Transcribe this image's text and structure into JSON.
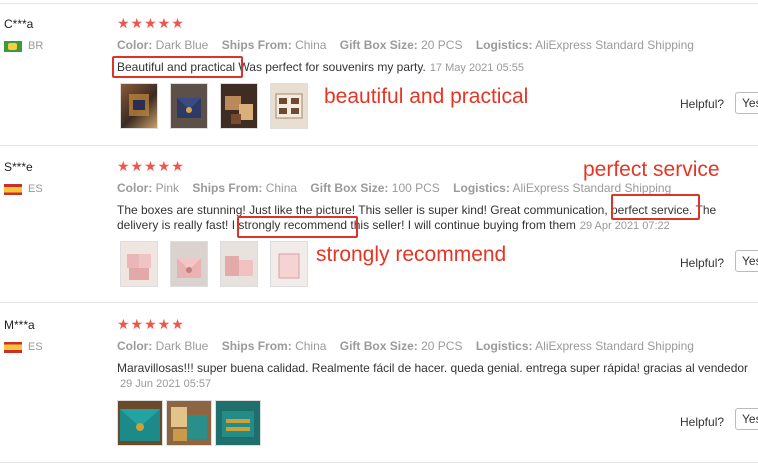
{
  "reviews": [
    {
      "user": "C***a",
      "country": "BR",
      "stars": "★★★★★",
      "attrs": {
        "color_label": "Color:",
        "color": "Dark Blue",
        "ships_label": "Ships From:",
        "ships": "China",
        "size_label": "Gift Box Size:",
        "size": "20 PCS",
        "logistics_label": "Logistics:",
        "logistics": "AliExpress Standard Shipping"
      },
      "text_a": "Beautiful and practical",
      "text_b": " Was perfect for souvenirs my party.",
      "date": "17 May 2021 05:55",
      "helpful": "Helpful?",
      "yes": "Yes"
    },
    {
      "user": "S***e",
      "country": "ES",
      "stars": "★★★★★",
      "attrs": {
        "color_label": "Color:",
        "color": "Pink",
        "ships_label": "Ships From:",
        "ships": "China",
        "size_label": "Gift Box Size:",
        "size": "100 PCS",
        "logistics_label": "Logistics:",
        "logistics": "AliExpress Standard Shipping"
      },
      "line1": "The boxes are stunning! Just like the picture! This seller is super kind! Great communication, perfect service. The",
      "line2": "delivery is really fast! I strongly recommend this seller! I will continue buying from them",
      "date": "29 Apr 2021 07:22",
      "helpful": "Helpful?",
      "yes": "Yes"
    },
    {
      "user": "M***a",
      "country": "ES",
      "stars": "★★★★★",
      "attrs": {
        "color_label": "Color:",
        "color": "Dark Blue",
        "ships_label": "Ships From:",
        "ships": "China",
        "size_label": "Gift Box Size:",
        "size": "20 PCS",
        "logistics_label": "Logistics:",
        "logistics": "AliExpress Standard Shipping"
      },
      "text": "Maravillosas!!! super buena calidad. Realmente fácil de hacer. queda genial. entrega super rápida! gracias al vendedor",
      "date": "29 Jun 2021 05:57",
      "helpful": "Helpful?",
      "yes": "Yes"
    }
  ],
  "annotations": {
    "a1": "beautiful and practical",
    "a2": "perfect service",
    "a3": "strongly recommend"
  },
  "colors": {
    "star": "#f0554d",
    "annotation": "#e53525"
  }
}
